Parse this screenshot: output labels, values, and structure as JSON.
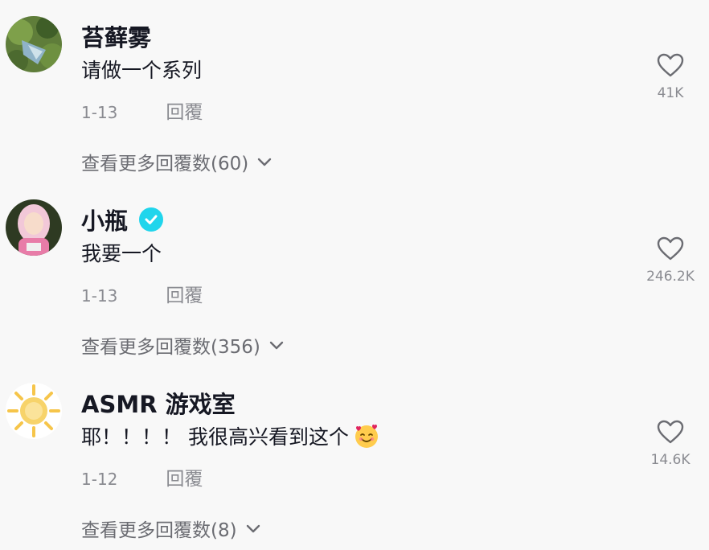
{
  "comments": [
    {
      "username": "苔藓雾",
      "text": "请做一个系列",
      "date": "1-13",
      "reply_label": "回覆",
      "likes": "41K",
      "more_replies": "查看更多回覆数(60)",
      "verified": false
    },
    {
      "username": "小瓶",
      "text": "我要一个",
      "date": "1-13",
      "reply_label": "回覆",
      "likes": "246.2K",
      "more_replies": "查看更多回覆数(356)",
      "verified": true
    },
    {
      "username": "ASMR 游戏室",
      "text": "耶！！！！ 我很高兴看到这个",
      "date": "1-12",
      "reply_label": "回覆",
      "likes": "14.6K",
      "more_replies": "查看更多回覆数(8)",
      "verified": false
    }
  ],
  "icons": {
    "like": "heart-outline-icon",
    "expand": "chevron-down-icon",
    "verified": "verified-check-icon",
    "emoji": "smiling-face-with-hearts-emoji"
  },
  "colors": {
    "background": "#f8f8f8",
    "text_primary": "#161823",
    "text_secondary": "#8a8b91",
    "verified_badge": "#20d5ec"
  }
}
